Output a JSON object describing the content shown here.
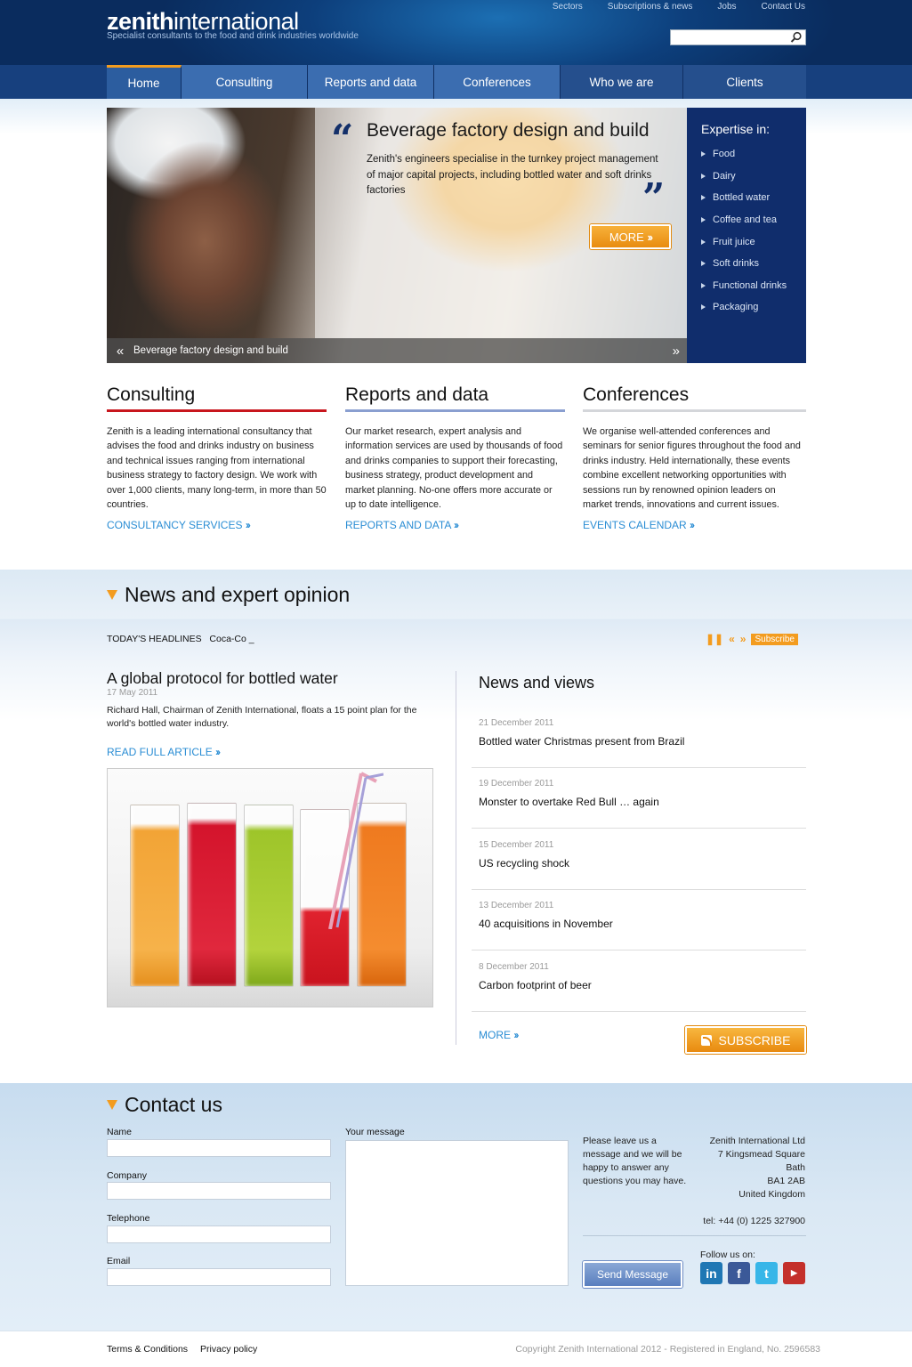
{
  "header": {
    "logo_bold": "zenith",
    "logo_light": "international",
    "tagline": "Specialist consultants to the food and drink industries worldwide",
    "top_links": [
      "Sectors",
      "Subscriptions & news",
      "Jobs",
      "Contact Us"
    ],
    "search_placeholder": ""
  },
  "nav": {
    "items": [
      "Home",
      "Consulting",
      "Reports and data",
      "Conferences",
      "Who we are",
      "Clients"
    ],
    "active": "Home"
  },
  "hero": {
    "title": "Beverage factory design and build",
    "text": "Zenith's engineers specialise in the turnkey project management of major capital projects, including bottled water and soft drinks factories",
    "more": "MORE",
    "caption": "Beverage factory design and build"
  },
  "expertise": {
    "title": "Expertise in:",
    "items": [
      "Food",
      "Dairy",
      "Bottled water",
      "Coffee and tea",
      "Fruit juice",
      "Soft drinks",
      "Functional drinks",
      "Packaging"
    ]
  },
  "columns": [
    {
      "title": "Consulting",
      "text": "Zenith is a leading international consultancy that advises the food and drinks industry on business and technical issues ranging from international business strategy to factory design. We work with over 1,000 clients, many long-term, in more than 50 countries.",
      "link": "CONSULTANCY SERVICES",
      "color": "#c8161d"
    },
    {
      "title": "Reports and data",
      "text": "Our market research, expert analysis and information services are used by thousands of food and drinks companies to support their forecasting, business strategy, product development and market planning. No-one offers more accurate or up to date intelligence.",
      "link": "REPORTS AND DATA",
      "color": "#8a9fd0"
    },
    {
      "title": "Conferences",
      "text": "We organise well-attended conferences and seminars for senior figures throughout the food and drinks industry. Held internationally, these events combine excellent networking opportunities with sessions run by renowned opinion leaders on market trends, innovations and current issues.",
      "link": "EVENTS CALENDAR",
      "color": "#d4d6da"
    }
  ],
  "news": {
    "title": "News and expert opinion",
    "headlines_label": "TODAY'S HEADLINES",
    "ticker": "Coca-Co _",
    "subscribe_small": "Subscribe",
    "article": {
      "title": "A global protocol for bottled water",
      "date": "17 May 2011",
      "summary": "Richard Hall, Chairman of Zenith International, floats a 15 point plan for the world's bottled water industry.",
      "link": "READ FULL ARTICLE"
    },
    "views_title": "News and views",
    "items": [
      {
        "date": "21 December 2011",
        "title": "Bottled water Christmas present from Brazil"
      },
      {
        "date": "19 December 2011",
        "title": "Monster to overtake Red Bull … again"
      },
      {
        "date": "15 December 2011",
        "title": "US recycling shock"
      },
      {
        "date": "13 December 2011",
        "title": "40 acquisitions in November"
      },
      {
        "date": "8 December 2011",
        "title": "Carbon footprint of beer"
      }
    ],
    "more": "MORE",
    "subscribe": "SUBSCRIBE"
  },
  "contact": {
    "title": "Contact us",
    "labels": {
      "name": "Name",
      "company": "Company",
      "telephone": "Telephone",
      "email": "Email",
      "message": "Your message"
    },
    "leave": "Please leave us a message and we will be happy to answer any questions you may have.",
    "address": [
      "Zenith International Ltd",
      "7 Kingsmead Square",
      "Bath",
      "BA1 2AB",
      "United Kingdom"
    ],
    "tel": "tel: +44 (0) 1225 327900",
    "send": "Send Message",
    "follow": "Follow us on:"
  },
  "footer": {
    "terms": "Terms & Conditions",
    "privacy": "Privacy policy",
    "copyright": "Copyright Zenith International 2012 - Registered in England, No. 2596583"
  },
  "colors": {
    "accent": "#f39c1f",
    "nav": "#17407e",
    "link": "#2a8dd4",
    "expertise_bg": "#102d6c"
  }
}
